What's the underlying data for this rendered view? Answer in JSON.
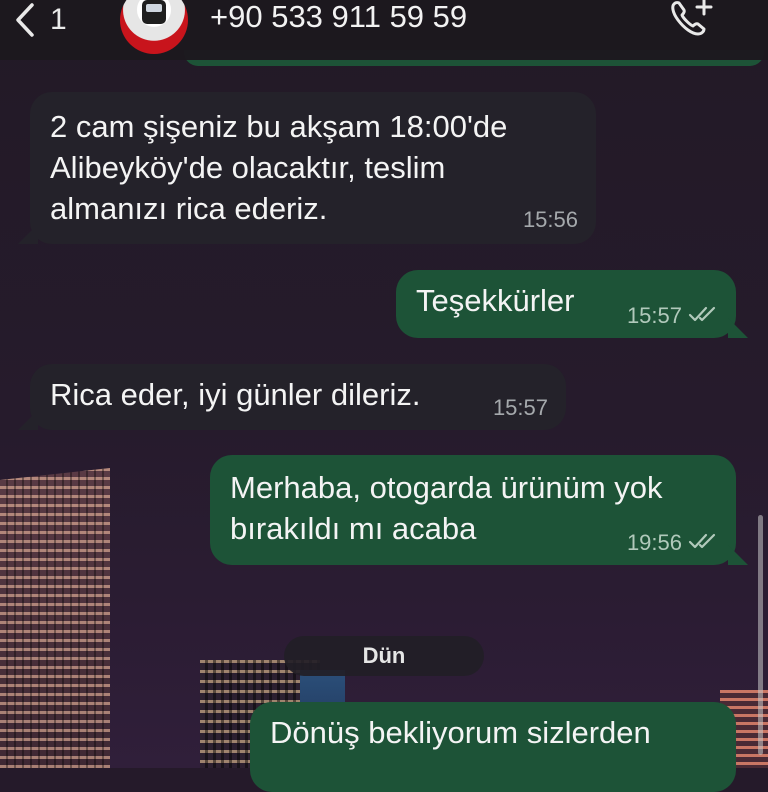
{
  "header": {
    "back_count": "1",
    "contact_name": "+90 533 911 59 59"
  },
  "messages": [
    {
      "direction": "in",
      "text": "2 cam şişeniz bu akşam 18:00'de\nAlibeyköy'de olacaktır, teslim\nalmanızı rica ederiz.",
      "time": "15:56"
    },
    {
      "direction": "out",
      "text": "Teşekkürler",
      "time": "15:57",
      "status": "read"
    },
    {
      "direction": "in",
      "text": "Rica eder, iyi günler dileriz.",
      "time": "15:57"
    },
    {
      "direction": "out",
      "text": "Merhaba, otogarda ürünüm yok\nbırakıldı mı acaba",
      "time": "19:56",
      "status": "read"
    },
    {
      "direction": "out",
      "text": "Dönüş bekliyorum sizlerden",
      "time": ""
    }
  ],
  "date_separator": "Dün",
  "colors": {
    "incoming_bubble": "#24222a",
    "outgoing_bubble": "#1d5337",
    "header_bg": "#1c181e"
  },
  "icons": {
    "back": "chevron-left-icon",
    "call": "phone-add-icon",
    "read_receipt": "double-check-icon"
  }
}
